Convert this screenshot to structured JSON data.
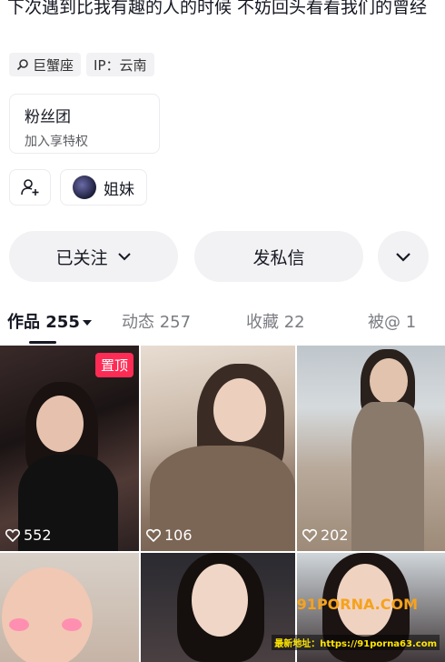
{
  "profile": {
    "bio": "下次遇到比我有趣的人的时候 不妨回头看看我们的曾经",
    "tags": [
      {
        "icon": "search-icon",
        "label": "巨蟹座"
      },
      {
        "label": "IP：云南"
      }
    ],
    "fans_group": {
      "title": "粉丝团",
      "subtitle": "加入享特权"
    },
    "group_chip": {
      "label": "姐妹"
    }
  },
  "actions": {
    "follow": "已关注",
    "message": "发私信"
  },
  "tabs": [
    {
      "label": "作品 255",
      "active": true
    },
    {
      "label": "动态 257"
    },
    {
      "label": "收藏 22"
    },
    {
      "label": "被@ 1"
    }
  ],
  "videos": [
    {
      "likes": "552",
      "pinned": "置顶"
    },
    {
      "likes": "106"
    },
    {
      "likes": "202"
    }
  ],
  "watermark": {
    "brand": "91PORNA.COM",
    "url": "最新地址：https://91porna63.com"
  },
  "colors": {
    "accent": "#fe2c55",
    "text": "#161823",
    "chip_bg": "#f2f2f4"
  }
}
